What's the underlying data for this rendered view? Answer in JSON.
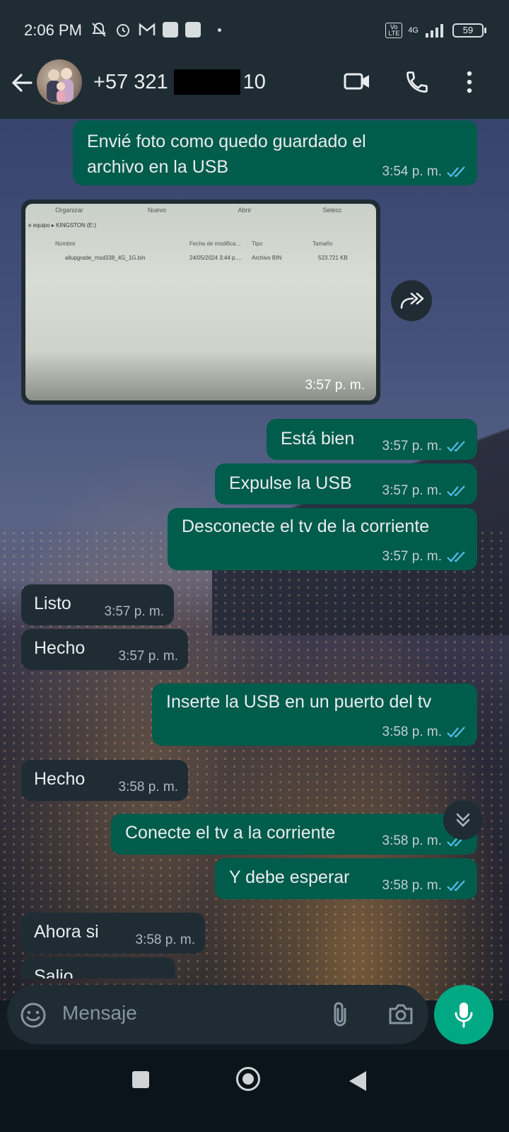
{
  "status_bar": {
    "time": "2:06 PM",
    "volte": "Vo LTE",
    "network": "4G",
    "battery": "59"
  },
  "header": {
    "contact_prefix": "+57 321",
    "contact_suffix": "10"
  },
  "messages": [
    {
      "dir": "out",
      "text": "Envié foto como quedo guardado el archivo en la USB",
      "time": "3:54 p. m."
    },
    {
      "dir": "in",
      "type": "image",
      "time": "3:57 p. m.",
      "image_text": {
        "toolbar": [
          "Organizar",
          "Nuevo",
          "Abrir",
          "Selecc"
        ],
        "path": "e equipo ▸ KINGSTON (E:)",
        "columns": [
          "Nombre",
          "Fecha de modifica...",
          "Tipo",
          "Tamaño"
        ],
        "row": [
          "allupgrade_msd338_4G_1G.bin",
          "24/05/2024 3:44 p....",
          "Archivo BIN",
          "523.721 KB"
        ]
      }
    },
    {
      "dir": "out",
      "text": "Está bien",
      "time": "3:57 p. m."
    },
    {
      "dir": "out",
      "text": "Expulse la USB",
      "time": "3:57 p. m."
    },
    {
      "dir": "out",
      "text": "Desconecte el tv de la corriente",
      "time": "3:57 p. m."
    },
    {
      "dir": "in",
      "text": "Listo",
      "time": "3:57 p. m."
    },
    {
      "dir": "in",
      "text": "Hecho",
      "time": "3:57 p. m."
    },
    {
      "dir": "out",
      "text": "Inserte la USB en un puerto del tv",
      "time": "3:58 p. m."
    },
    {
      "dir": "in",
      "text": "Hecho",
      "time": "3:58 p. m."
    },
    {
      "dir": "out",
      "text": "Conecte el tv a la corriente",
      "time": "3:58 p. m."
    },
    {
      "dir": "out",
      "text": "Y debe esperar",
      "time": "3:58 p. m."
    },
    {
      "dir": "in",
      "text": "Ahora si",
      "time": "3:58 p. m."
    },
    {
      "dir": "in",
      "text": "Salio",
      "time": ""
    }
  ],
  "input": {
    "placeholder": "Mensaje"
  },
  "colors": {
    "outgoing_bubble": "#005c4b",
    "incoming_bubble": "#1f2c34",
    "accent": "#00a884",
    "read_ticks": "#53bdeb"
  }
}
